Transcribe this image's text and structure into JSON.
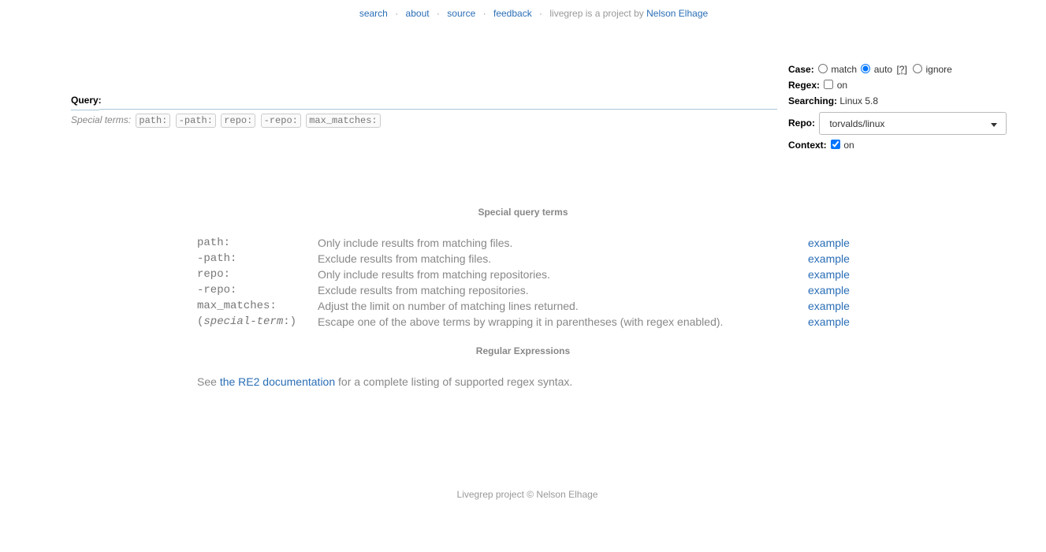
{
  "nav": {
    "search": "search",
    "about": "about",
    "source": "source",
    "feedback": "feedback",
    "separator": "·",
    "credit_prefix": "livegrep is a project by",
    "author": "Nelson Elhage"
  },
  "query": {
    "label": "Query:",
    "value": "",
    "special_terms_label": "Special terms:",
    "chips": [
      "path:",
      "-path:",
      "repo:",
      "-repo:",
      "max_matches:"
    ]
  },
  "options": {
    "case_label": "Case:",
    "case_options": [
      "match",
      "auto",
      "ignore"
    ],
    "case_selected": "auto",
    "case_help": "[?]",
    "regex_label": "Regex:",
    "regex_value": "on",
    "regex_checked": false,
    "searching_label": "Searching:",
    "searching_value": "Linux 5.8",
    "repo_label": "Repo:",
    "repo_selected": "torvalds/linux",
    "context_label": "Context:",
    "context_value": "on",
    "context_checked": true
  },
  "help": {
    "special_title": "Special query terms",
    "rows": [
      {
        "term": "path:",
        "desc": "Only include results from matching files.",
        "link": "example"
      },
      {
        "term": "-path:",
        "desc": "Exclude results from matching files.",
        "link": "example"
      },
      {
        "term": "repo:",
        "desc": "Only include results from matching repositories.",
        "link": "example"
      },
      {
        "term": "-repo:",
        "desc": "Exclude results from matching repositories.",
        "link": "example"
      },
      {
        "term": "max_matches:",
        "desc": "Adjust the limit on number of matching lines returned.",
        "link": "example"
      },
      {
        "term_open": "(",
        "term_italic": "special-term",
        "term_close": ":)",
        "desc": "Escape one of the above terms by wrapping it in parentheses (with regex enabled).",
        "link": "example"
      }
    ],
    "regex_title": "Regular Expressions",
    "re2_prefix": "See",
    "re2_link": "the RE2 documentation",
    "re2_suffix": "for a complete listing of supported regex syntax."
  },
  "footer": "Livegrep project © Nelson Elhage",
  "colors": {
    "link": "#2a6eb6",
    "muted": "#888888"
  }
}
